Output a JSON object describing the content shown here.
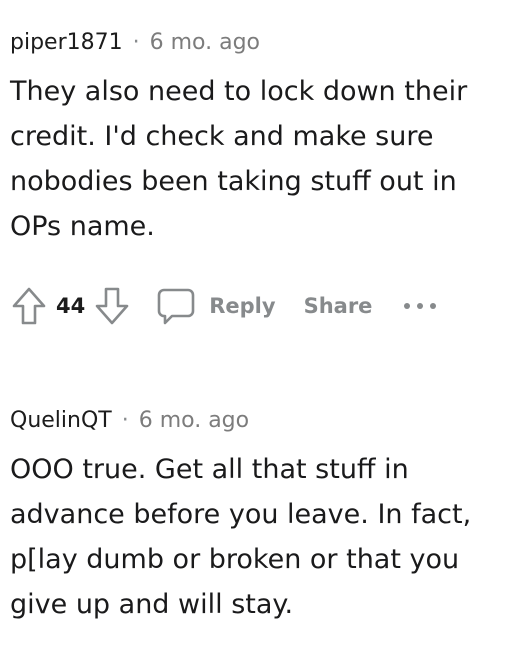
{
  "comments": [
    {
      "username": "piper1871",
      "separator": "·",
      "time": "6 mo. ago",
      "body": "They also need to lock down their\ncredit. I'd check and make sure\nnobodies been taking stuff out in\nOPs name.",
      "votes": "44",
      "reply_label": "Reply",
      "share_label": "Share"
    },
    {
      "username": "QuelinQT",
      "separator": "·",
      "time": "6 mo. ago",
      "body": "OOO true. Get all that stuff in\nadvance before you leave. In fact,\np[lay dumb or broken or that you\ngive up and will stay."
    }
  ],
  "icons": {
    "upvote": "upvote-arrow-icon",
    "downvote": "downvote-arrow-icon",
    "reply": "speech-bubble-icon",
    "more": "ellipsis-icon"
  },
  "colors": {
    "text": "#1a1a1b",
    "meta_muted": "#7c7c7c",
    "action_muted": "#878a8c"
  }
}
